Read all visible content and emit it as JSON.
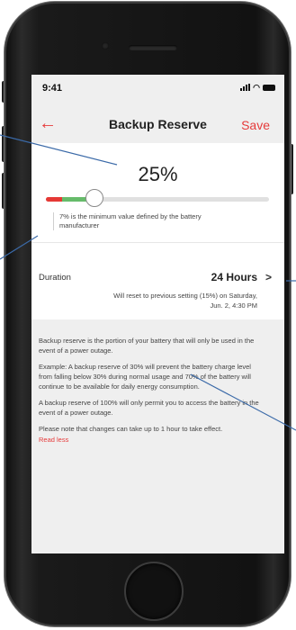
{
  "status_bar": {
    "time": "9:41"
  },
  "nav": {
    "back_icon": "←",
    "title": "Backup Reserve",
    "save_label": "Save"
  },
  "reserve": {
    "value_text": "25%",
    "value": 25,
    "minimum_note": "7% is the minimum value defined by the battery manufacturer"
  },
  "duration": {
    "label": "Duration",
    "value": "24 Hours",
    "chevron": ">",
    "reset_note": "Will reset to previous setting (15%) on Saturday, Jun. 2, 4:30 PM"
  },
  "info": {
    "paragraphs": [
      "Backup reserve is the portion of your battery that will only be used in the event of a power outage.",
      "Example: A backup reserve of 30% will prevent the battery charge level from falling below 30% during normal usage and 70% of the battery will continue to be available for daily energy consumption.",
      "A backup reserve of 100% will only permit you to access the battery in the event of a power outage.",
      "Please note that changes can take up to 1 hour to take effect."
    ],
    "read_less_label": "Read less"
  },
  "colors": {
    "accent": "#e63b3b",
    "slider_fill": "#66bb6a",
    "connector": "#3b6aa8"
  }
}
